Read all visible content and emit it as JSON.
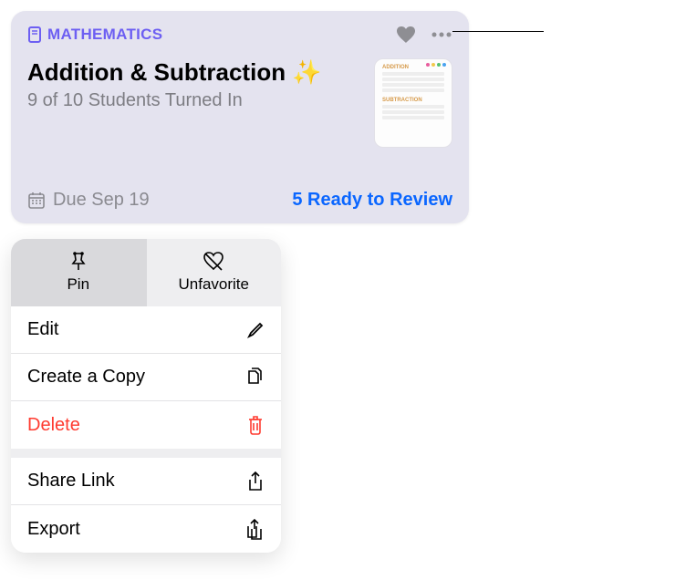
{
  "card": {
    "class_label": "MATHEMATICS",
    "title": "Addition & Subtraction ✨",
    "subtitle": "9 of 10 Students Turned In",
    "due_label": "Due Sep 19",
    "ready_label": "5 Ready to Review"
  },
  "thumb": {
    "heading1": "ADDITION",
    "heading2": "SUBTRACTION"
  },
  "menu": {
    "pin_label": "Pin",
    "unfavorite_label": "Unfavorite",
    "edit_label": "Edit",
    "copy_label": "Create a Copy",
    "delete_label": "Delete",
    "share_label": "Share Link",
    "export_label": "Export"
  }
}
